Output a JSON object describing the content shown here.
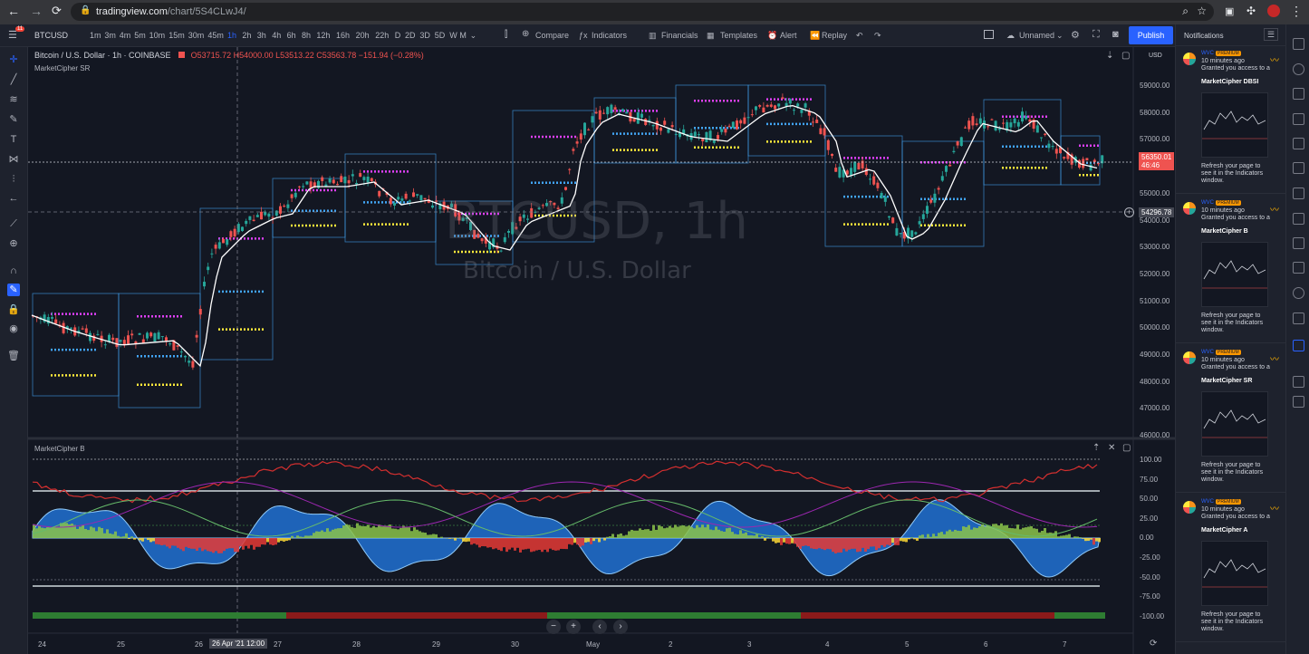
{
  "browser": {
    "url_host": "tradingview.com",
    "url_path": "/chart/5S4CLwJ4/",
    "ext_badge": "11"
  },
  "toolbar": {
    "symbol": "BTCUSD",
    "intervals": [
      "1m",
      "3m",
      "4m",
      "5m",
      "10m",
      "15m",
      "30m",
      "45m",
      "1h",
      "2h",
      "3h",
      "4h",
      "6h",
      "8h",
      "12h",
      "16h",
      "20h",
      "22h",
      "D",
      "2D",
      "3D",
      "5D",
      "W",
      "M"
    ],
    "active_interval": "1h",
    "compare": "Compare",
    "indicators": "Indicators",
    "financials": "Financials",
    "templates": "Templates",
    "alert": "Alert",
    "replay": "Replay",
    "layout_name": "Unnamed",
    "publish": "Publish"
  },
  "legend": {
    "title": "Bitcoin / U.S. Dollar · 1h · COINBASE",
    "ohlc": "O53715.72 H54000.00 L53513.22 C53563.78 −151.94 (−0.28%)",
    "indicator_main": "MarketCipher SR",
    "indicator_sub": "MarketCipher B"
  },
  "watermark": {
    "symbol": "BTCUSD, 1h",
    "description": "Bitcoin / U.S. Dollar"
  },
  "price_axis": {
    "currency": "USD",
    "main_ticks": [
      "59000.00",
      "58000.00",
      "57000.00",
      "56000.00",
      "55000.00",
      "54000.00",
      "53000.00",
      "52000.00",
      "51000.00",
      "50000.00",
      "49000.00",
      "48000.00",
      "47000.00",
      "46000.00"
    ],
    "current_price": "56350.01",
    "countdown": "46:46",
    "crosshair_price": "54296.78",
    "sub_ticks": [
      "100.00",
      "75.00",
      "50.00",
      "25.00",
      "0.00",
      "-25.00",
      "-50.00",
      "-75.00",
      "-100.00"
    ]
  },
  "time_axis": {
    "labels": [
      "24",
      "25",
      "26",
      "27",
      "28",
      "29",
      "30",
      "May",
      "2",
      "3",
      "4",
      "5",
      "6",
      "7"
    ],
    "crosshair_time": "26 Apr '21   12:00"
  },
  "notifications": {
    "title": "Notifications",
    "items": [
      {
        "user": "WVC",
        "badge": "PREMIUM",
        "time": "10 minutes ago",
        "message": "Granted you access to a",
        "indicator": "MarketCipher DBSI",
        "refresh": "Refresh your page to see it in the Indicators window."
      },
      {
        "user": "WVC",
        "badge": "PREMIUM",
        "time": "10 minutes ago",
        "message": "Granted you access to a",
        "indicator": "MarketCipher B",
        "refresh": "Refresh your page to see it in the Indicators window."
      },
      {
        "user": "WVC",
        "badge": "PREMIUM",
        "time": "10 minutes ago",
        "message": "Granted you access to a",
        "indicator": "MarketCipher SR",
        "refresh": "Refresh your page to see it in the Indicators window."
      },
      {
        "user": "WVC",
        "badge": "PREMIUM",
        "time": "10 minutes ago",
        "message": "Granted you access to a",
        "indicator": "MarketCipher A",
        "refresh": "Refresh your page to see it in the Indicators window."
      }
    ]
  },
  "colors": {
    "bg": "#131722",
    "up": "#26a69a",
    "down": "#ef5350",
    "accent": "#2962ff",
    "sr_magenta": "#e040fb",
    "sr_yellow": "#ffeb3b",
    "sr_blue": "#42a5f5",
    "wave_blue": "#1e63b8"
  }
}
